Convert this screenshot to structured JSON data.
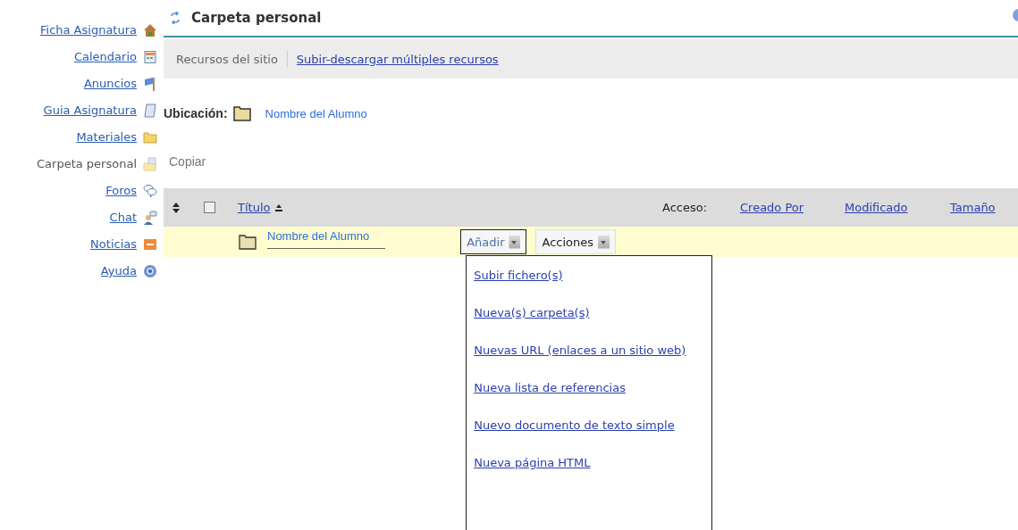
{
  "sidebar": {
    "items": [
      {
        "label": "Ficha Asignatura",
        "selected": false
      },
      {
        "label": "Calendario",
        "selected": false
      },
      {
        "label": "Anuncios",
        "selected": false
      },
      {
        "label": "Guia Asignatura",
        "selected": false
      },
      {
        "label": "Materiales",
        "selected": false
      },
      {
        "label": "Carpeta personal",
        "selected": true
      },
      {
        "label": "Foros",
        "selected": false
      },
      {
        "label": "Chat",
        "selected": false
      },
      {
        "label": "Noticias",
        "selected": false
      },
      {
        "label": "Ayuda",
        "selected": false
      }
    ]
  },
  "header": {
    "title": "Carpeta personal"
  },
  "toolbar": {
    "items": [
      {
        "label": "Recursos del sitio",
        "selected": true
      },
      {
        "label": "Subir-descargar múltiples recursos",
        "selected": false
      }
    ]
  },
  "location": {
    "label": "Ubicación:",
    "folder": "Nombre del Alumno"
  },
  "actions": {
    "copy": "Copiar"
  },
  "table": {
    "select_all": {
      "checked": false
    },
    "columns": {
      "title": "Título",
      "access": "Acceso:",
      "created_by": "Creado Por",
      "modified": "Modificado",
      "size": "Tamaño"
    },
    "rows": [
      {
        "name": "Nombre del Alumno",
        "add_button": "Añadir",
        "actions_button": "Acciones"
      }
    ]
  },
  "add_menu": {
    "items": [
      "Subir fichero(s)",
      "Nueva(s) carpeta(s)",
      "Nuevas URL (enlaces a un sitio web)",
      "Nueva lista de referencias",
      "Nuevo documento de texto simple",
      "Nueva página HTML"
    ]
  }
}
